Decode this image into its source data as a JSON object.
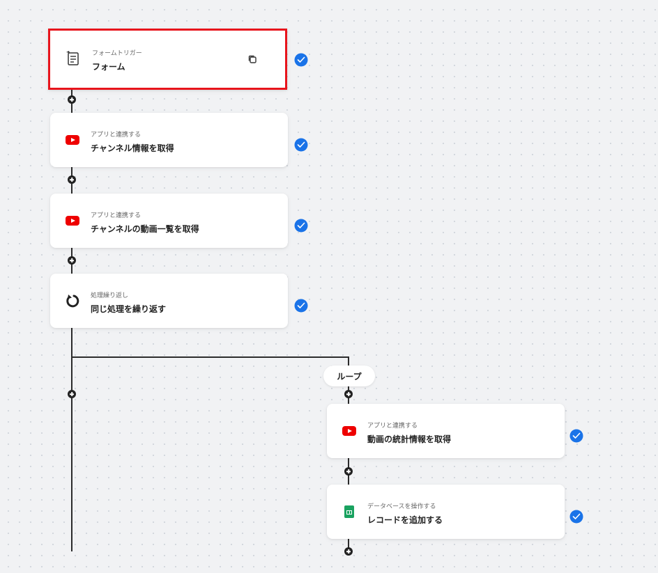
{
  "loop_label": "ループ",
  "steps": [
    {
      "subtitle": "フォームトリガー",
      "title": "フォーム",
      "icon": "form-icon",
      "selected": true
    },
    {
      "subtitle": "アプリと連携する",
      "title": "チャンネル情報を取得",
      "icon": "youtube-icon"
    },
    {
      "subtitle": "アプリと連携する",
      "title": "チャンネルの動画一覧を取得",
      "icon": "youtube-icon"
    },
    {
      "subtitle": "処理繰り返し",
      "title": "同じ処理を繰り返す",
      "icon": "loop-icon"
    },
    {
      "subtitle": "アプリと連携する",
      "title": "動画の統計情報を取得",
      "icon": "youtube-icon"
    },
    {
      "subtitle": "データベースを操作する",
      "title": "レコードを追加する",
      "icon": "google-sheets-icon"
    }
  ],
  "colors": {
    "accent": "#1a73e8",
    "selection": "#e8141c",
    "youtube": "#ee0000",
    "sheets": "#1aa260"
  }
}
